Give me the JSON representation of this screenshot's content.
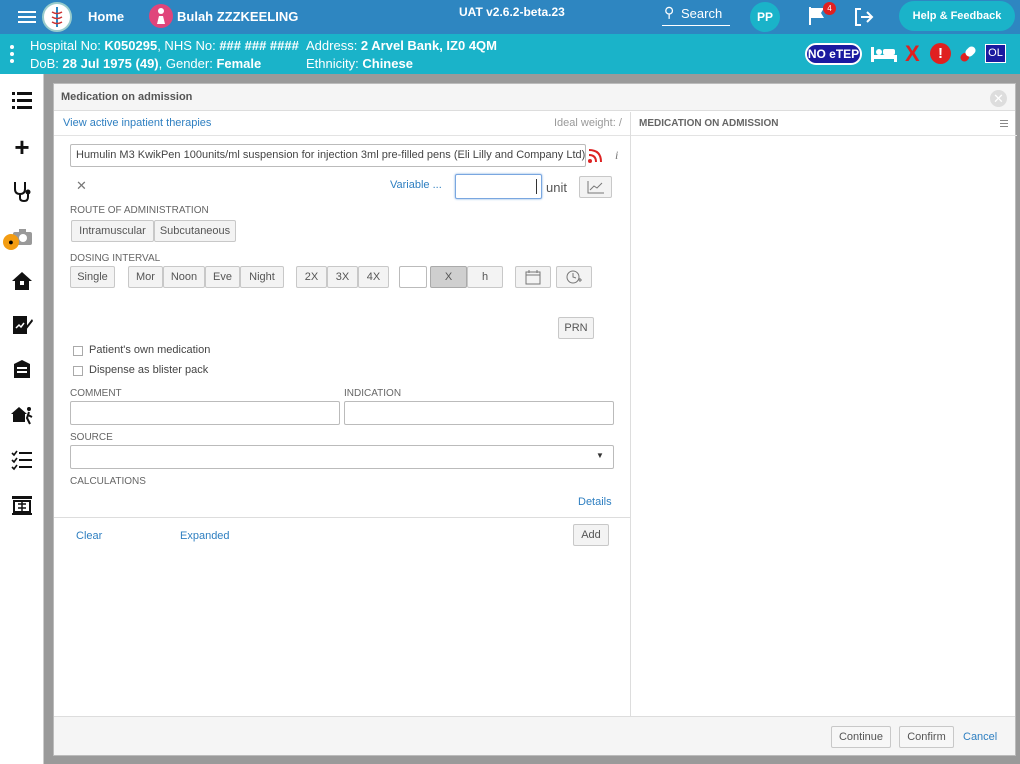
{
  "topbar": {
    "home_label": "Home",
    "patient_name": "Bulah ZZZKEELING",
    "version": "UAT v2.6.2-beta.23",
    "search_label": "Search",
    "user_initials": "PP",
    "flag_count": "4",
    "help_label": "Help & Feedback"
  },
  "patient": {
    "hospital_prefix": "Hospital No: ",
    "hospital_no": "K050295",
    "nhs_prefix": ", NHS No: ",
    "nhs_no": "### ### ####",
    "dob_prefix": "DoB: ",
    "dob": "28 Jul 1975 (49)",
    "gender_prefix": ", Gender: ",
    "gender": "Female",
    "address_prefix": "Address: ",
    "address": "2 Arvel Bank, IZ0 4QM",
    "ethnicity_prefix": "Ethnicity: ",
    "ethnicity": "Chinese",
    "no_etep": "NO eTEP",
    "ol_badge": "OL",
    "x_mark": "X"
  },
  "modal": {
    "title": "Medication on admission",
    "view_therapies": "View active inpatient therapies",
    "ideal_weight": "Ideal weight: /",
    "right_header": "MEDICATION ON ADMISSION",
    "medication_value": "Humulin M3 KwikPen 100units/ml suspension for injection 3ml pre-filled pens (Eli Lilly and Company Ltd)",
    "variable_label": "Variable ...",
    "unit_label": "unit",
    "route_caption": "ROUTE OF ADMINISTRATION",
    "route_options": [
      "Intramuscular",
      "Subcutaneous"
    ],
    "dosing_caption": "DOSING INTERVAL",
    "single_label": "Single",
    "times": [
      "Mor",
      "Noon",
      "Eve",
      "Night"
    ],
    "multiples": [
      "2X",
      "3X",
      "4X"
    ],
    "x_label": "X",
    "h_label": "h",
    "prn_label": "PRN",
    "patients_own": "Patient's own medication",
    "blister_pack": "Dispense as blister pack",
    "comment_caption": "COMMENT",
    "indication_caption": "INDICATION",
    "source_caption": "SOURCE",
    "calculations_caption": "CALCULATIONS",
    "details_label": "Details",
    "clear_label": "Clear",
    "expanded_label": "Expanded",
    "add_label": "Add",
    "continue_label": "Continue",
    "confirm_label": "Confirm",
    "cancel_label": "Cancel"
  },
  "colors": {
    "topbar": "#2e86c1",
    "patient_bar": "#1ab3c9",
    "link": "#2e7fc1",
    "alert_red": "#e02020",
    "navy_badge": "#1a1aa0"
  }
}
